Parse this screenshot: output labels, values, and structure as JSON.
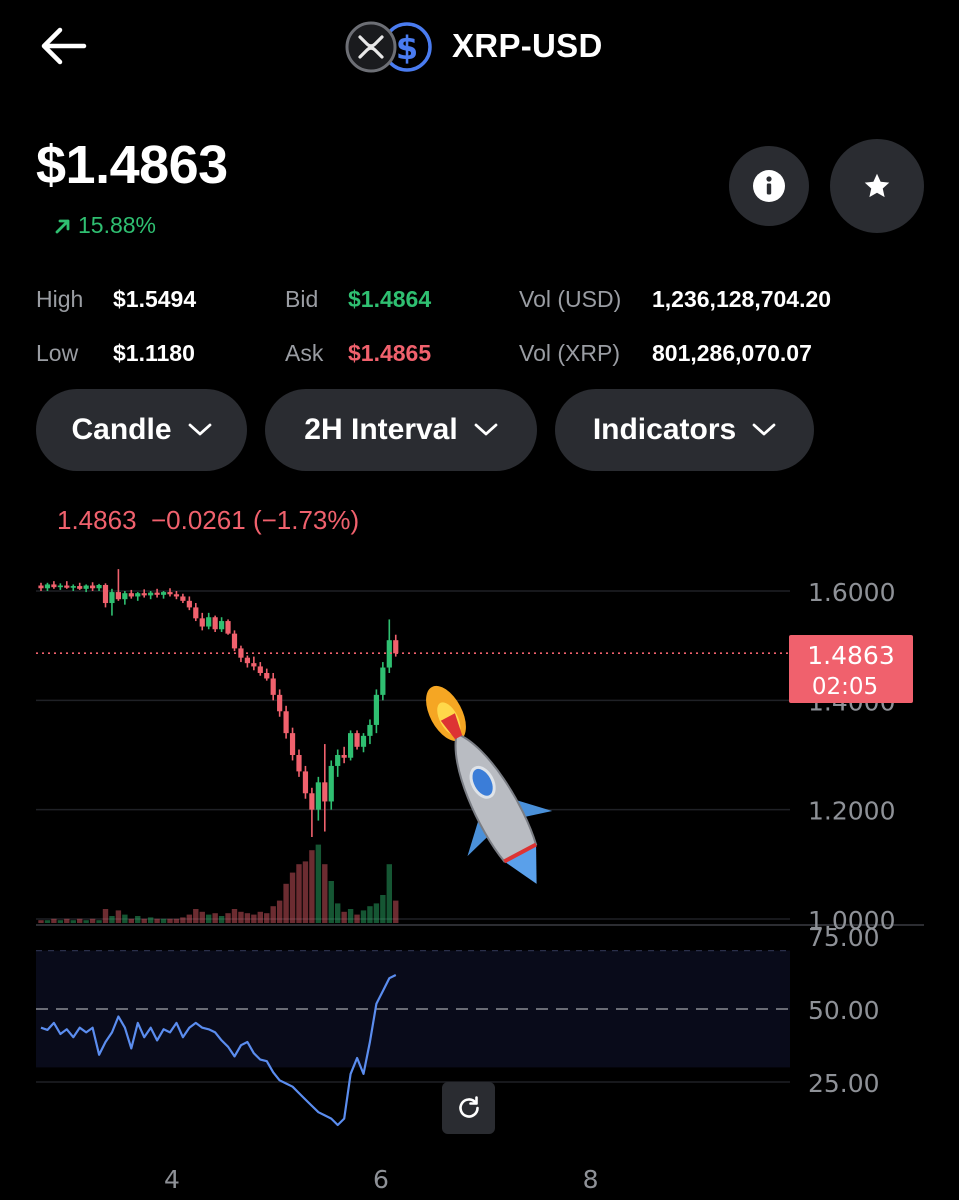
{
  "header": {
    "back_icon": "arrow-left-icon",
    "pair": "XRP-USD",
    "base_icon": "xrp-coin-icon",
    "quote_icon": "usd-coin-icon"
  },
  "price": {
    "value": "$1.4863",
    "change": "15.88%",
    "change_icon": "arrow-up-right-icon"
  },
  "actions": {
    "info_icon": "info-icon",
    "favorite_icon": "star-icon"
  },
  "stats": {
    "high_label": "High",
    "high_value": "$1.5494",
    "low_label": "Low",
    "low_value": "$1.1180",
    "bid_label": "Bid",
    "bid_value": "$1.4864",
    "ask_label": "Ask",
    "ask_value": "$1.4865",
    "vol_usd_label": "Vol (USD)",
    "vol_usd_value": "1,236,128,704.20",
    "vol_xrp_label": "Vol (XRP)",
    "vol_xrp_value": "801,286,070.07"
  },
  "controls": {
    "chart_type": "Candle",
    "interval": "2H Interval",
    "indicators": "Indicators"
  },
  "chart_header": {
    "last": "1.4863",
    "change": "−0.0261",
    "change_pct": "(−1.73%)"
  },
  "colors": {
    "up": "#2fbf71",
    "down": "#f0616d",
    "rsi_line": "#5b8def",
    "panel": "#2a2c31"
  },
  "chart_data": {
    "type": "candlestick",
    "price_axis_ticks": [
      "1.6000",
      "1.4000",
      "1.2000",
      "1.0000"
    ],
    "price_ylim": [
      1.0,
      1.6
    ],
    "current_price_tag": "1.4863",
    "countdown_tag": "02:05",
    "x_tick_labels": [
      "4",
      "6",
      "8"
    ],
    "x_ticks_index": [
      20.3,
      52.7,
      85.2
    ],
    "rsi_ticks": [
      "75.00",
      "50.00",
      "25.00"
    ],
    "rsi_ylim": [
      25,
      75
    ],
    "rsi_band": [
      30,
      70
    ],
    "candles": [
      [
        1.61,
        1.615,
        1.6,
        1.605
      ],
      [
        1.605,
        1.615,
        1.6,
        1.612
      ],
      [
        1.612,
        1.618,
        1.604,
        1.607
      ],
      [
        1.607,
        1.614,
        1.602,
        1.61
      ],
      [
        1.61,
        1.618,
        1.604,
        1.606
      ],
      [
        1.606,
        1.612,
        1.6,
        1.609
      ],
      [
        1.609,
        1.615,
        1.602,
        1.604
      ],
      [
        1.604,
        1.612,
        1.598,
        1.61
      ],
      [
        1.61,
        1.616,
        1.6,
        1.605
      ],
      [
        1.605,
        1.613,
        1.6,
        1.611
      ],
      [
        1.611,
        1.614,
        1.57,
        1.578
      ],
      [
        1.578,
        1.604,
        1.555,
        1.598
      ],
      [
        1.598,
        1.64,
        1.582,
        1.585
      ],
      [
        1.585,
        1.6,
        1.575,
        1.596
      ],
      [
        1.596,
        1.602,
        1.586,
        1.59
      ],
      [
        1.59,
        1.598,
        1.582,
        1.596
      ],
      [
        1.596,
        1.603,
        1.588,
        1.592
      ],
      [
        1.592,
        1.6,
        1.585,
        1.597
      ],
      [
        1.597,
        1.604,
        1.588,
        1.593
      ],
      [
        1.593,
        1.6,
        1.586,
        1.598
      ],
      [
        1.598,
        1.605,
        1.59,
        1.594
      ],
      [
        1.594,
        1.6,
        1.585,
        1.59
      ],
      [
        1.59,
        1.595,
        1.578,
        1.582
      ],
      [
        1.582,
        1.59,
        1.565,
        1.57
      ],
      [
        1.57,
        1.578,
        1.545,
        1.55
      ],
      [
        1.55,
        1.56,
        1.528,
        1.535
      ],
      [
        1.535,
        1.56,
        1.53,
        1.552
      ],
      [
        1.552,
        1.555,
        1.525,
        1.53
      ],
      [
        1.53,
        1.552,
        1.525,
        1.545
      ],
      [
        1.545,
        1.548,
        1.52,
        1.522
      ],
      [
        1.522,
        1.528,
        1.49,
        1.495
      ],
      [
        1.495,
        1.5,
        1.47,
        1.478
      ],
      [
        1.478,
        1.482,
        1.46,
        1.468
      ],
      [
        1.468,
        1.48,
        1.455,
        1.462
      ],
      [
        1.462,
        1.47,
        1.445,
        1.45
      ],
      [
        1.45,
        1.458,
        1.436,
        1.44
      ],
      [
        1.44,
        1.45,
        1.4,
        1.41
      ],
      [
        1.41,
        1.42,
        1.37,
        1.38
      ],
      [
        1.38,
        1.39,
        1.33,
        1.34
      ],
      [
        1.34,
        1.35,
        1.29,
        1.3
      ],
      [
        1.3,
        1.31,
        1.26,
        1.27
      ],
      [
        1.27,
        1.28,
        1.22,
        1.23
      ],
      [
        1.23,
        1.24,
        1.15,
        1.2
      ],
      [
        1.2,
        1.26,
        1.18,
        1.25
      ],
      [
        1.25,
        1.32,
        1.16,
        1.215
      ],
      [
        1.215,
        1.29,
        1.2,
        1.28
      ],
      [
        1.28,
        1.31,
        1.26,
        1.3
      ],
      [
        1.3,
        1.315,
        1.285,
        1.295
      ],
      [
        1.295,
        1.345,
        1.29,
        1.34
      ],
      [
        1.34,
        1.345,
        1.31,
        1.315
      ],
      [
        1.315,
        1.34,
        1.305,
        1.335
      ],
      [
        1.335,
        1.365,
        1.32,
        1.355
      ],
      [
        1.355,
        1.42,
        1.34,
        1.41
      ],
      [
        1.41,
        1.47,
        1.4,
        1.46
      ],
      [
        1.46,
        1.548,
        1.45,
        1.51
      ],
      [
        1.51,
        1.52,
        1.48,
        1.486
      ]
    ],
    "volumes": [
      0.02,
      0.02,
      0.03,
      0.02,
      0.03,
      0.02,
      0.03,
      0.02,
      0.03,
      0.02,
      0.1,
      0.05,
      0.09,
      0.06,
      0.03,
      0.05,
      0.03,
      0.04,
      0.03,
      0.03,
      0.03,
      0.03,
      0.04,
      0.06,
      0.1,
      0.08,
      0.06,
      0.07,
      0.05,
      0.07,
      0.1,
      0.08,
      0.07,
      0.06,
      0.08,
      0.07,
      0.12,
      0.16,
      0.28,
      0.36,
      0.42,
      0.44,
      0.52,
      0.56,
      0.42,
      0.3,
      0.14,
      0.08,
      0.1,
      0.06,
      0.09,
      0.12,
      0.14,
      0.2,
      0.42,
      0.16
    ],
    "rsi": [
      44.5,
      43.8,
      46,
      42.5,
      44,
      41.5,
      44.5,
      43,
      44.5,
      36,
      40,
      43,
      48,
      44.5,
      38,
      46,
      41.5,
      44.5,
      40.5,
      44,
      43,
      46,
      41.5,
      44.5,
      46,
      44.5,
      44,
      43,
      40.5,
      38.5,
      35.5,
      39,
      40,
      36.5,
      34.5,
      34,
      30.5,
      28,
      27,
      26,
      24,
      22,
      20,
      18,
      17,
      16,
      14,
      16,
      30,
      35,
      30,
      40,
      52,
      56,
      60,
      61
    ],
    "illustration": "rocket-emoji"
  }
}
